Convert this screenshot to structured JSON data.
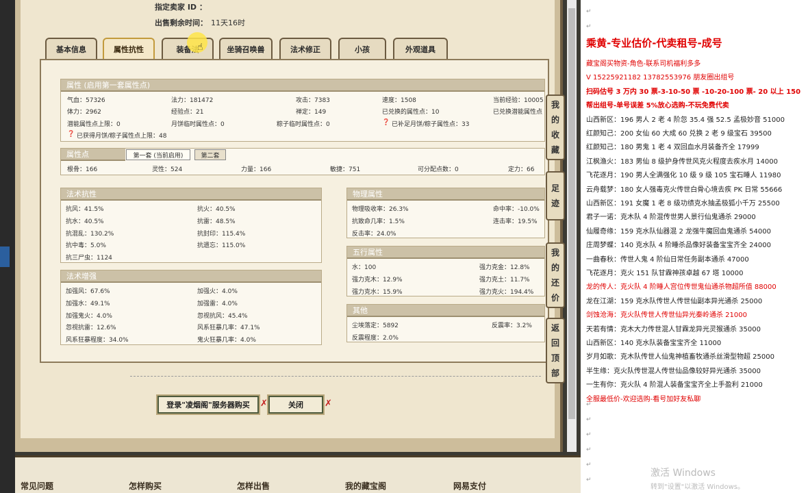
{
  "header": {
    "seller_id_label": "指定卖家 ID ：",
    "time_label": "出售剩余时间：",
    "time_value": "11天16时"
  },
  "tabs": [
    "基本信息",
    "属性抗性",
    "装备法",
    "坐骑召唤兽",
    "法术修正",
    "小孩",
    "外观道具"
  ],
  "attr_section": {
    "title": "属性 (启用第一套属性点)",
    "rows": [
      [
        "气血：57326",
        "法力：181472",
        "攻击：7383",
        "速度：1508",
        "当前经验：10005"
      ],
      [
        "体力：2962",
        "经验点：21",
        "禅定：149",
        "已兑换的属性点：10",
        "已兑换潜能属性点"
      ],
      [
        "潜能属性点上限：0",
        "月饼临时属性点：0",
        "粽子临时属性点：0",
        "已补足月饼/粽子属性点：33"
      ]
    ],
    "note": "已获得月饼/粽子属性点上限：48"
  },
  "points_section": {
    "title": "属性点",
    "subtab1": "第一套 (当前启用)",
    "subtab2": "第二套",
    "row": [
      "根骨：166",
      "灵性：524",
      "力量：166",
      "敏捷：751",
      "可分配点数：0",
      "定力：66"
    ]
  },
  "spell_resist": {
    "title": "法术抗性",
    "items": [
      "抗风：41.5%",
      "抗火：40.5%",
      "抗水：40.5%",
      "抗雷：48.5%",
      "抗混乱：130.2%",
      "抗封印：115.4%",
      "抗中毒：5.0%",
      "抗遗忘：115.0%",
      "抗三尸虫：1124"
    ]
  },
  "spell_boost": {
    "title": "法术增强",
    "items": [
      "加强风：67.6%",
      "加强火：4.0%",
      "加强水：49.1%",
      "加强雷：4.0%",
      "加强鬼火：4.0%",
      "忽视抗风：45.4%",
      "忽视抗雷：12.6%",
      "风系狂暴几率：47.1%",
      "风系狂暴程度：34.0%",
      "鬼火狂暴几率：4.0%"
    ]
  },
  "physical": {
    "title": "物理属性",
    "items": [
      "物理吸收率：26.3%",
      "命中率：-10.0%",
      "抗致命几率：1.5%",
      "连击率：19.5%",
      "反击率：24.0%"
    ]
  },
  "wuxing": {
    "title": "五行属性",
    "items": [
      "水：100",
      "强力克金：12.8%",
      "强力克木：12.9%",
      "强力克土：11.7%",
      "强力克水：15.9%",
      "强力克火：194.4%"
    ]
  },
  "other": {
    "title": "其他",
    "items": [
      "尘埃落定：5892",
      "反震率：3.2%",
      "反震程度：2.0%"
    ]
  },
  "side_buttons": [
    [
      "我",
      "的",
      "收",
      "藏"
    ],
    [
      "足",
      "迹"
    ],
    [
      "我",
      "的",
      "还",
      "价"
    ],
    [
      "返",
      "回",
      "顶",
      "部"
    ]
  ],
  "bottom_buttons": {
    "login": "登录\"凌烟阁\"服务器购买",
    "close": "关闭",
    "x": "✗"
  },
  "footer": [
    "常见问题",
    "怎样购买",
    "怎样出售",
    "我的藏宝阁",
    "网易支付"
  ],
  "doc": {
    "title": "乘黄-专业估价-代卖租号-成号",
    "mark": "↵",
    "lines": [
      {
        "t": "藏宝阁买物资-角色-联系司机福利多多",
        "c": "red"
      },
      {
        "t": "V 15225921182   13782553976 朋友圈出组号",
        "c": "red"
      },
      {
        "t": "扫码估号 3 万内 30 票-3-10-50 票  -10-20-100 票- 20 以上 150",
        "c": "redb"
      },
      {
        "t": "帮出组号-单号误差 5%放心选购-不玩免费代卖",
        "c": "redb"
      },
      {
        "t": "山西新区：196 男人 2 老 4 阶忽 35.4 强 52.5 孟极妙音 51000",
        "c": ""
      },
      {
        "t": "红颜知己：200 女仙 60 大成 60 兑换 2 老 9 级宝石 39500",
        "c": ""
      },
      {
        "t": "红颜知己：180 男鬼 1 老 4 双回血水月装备齐全 17999",
        "c": ""
      },
      {
        "t": "江枫渔火：183 男仙 8 级护身传世风克火程度去疾水月 14000",
        "c": ""
      },
      {
        "t": "飞花逐月：190 男人全满强化 10 级 9 级 105 宝石睡人 11980",
        "c": ""
      },
      {
        "t": "云舟载梦：180 女人强毒克火传世白骨心境去疾 PK 日常 55666",
        "c": ""
      },
      {
        "t": "山西新区：191 女魔 1 老 8 级功绩克水抽孟极狐小千万 25500",
        "c": ""
      },
      {
        "t": "君子一诺：克木队 4 阶混传世男人景行仙鬼通杀 29000",
        "c": ""
      },
      {
        "t": "仙履奇缘：159 克水队仙器混 2 龙强牛魔回血鬼通杀 54000",
        "c": ""
      },
      {
        "t": "庄周梦蝶：140 克水队 4 阶睡杀品像好装备宝宝齐全 24000",
        "c": ""
      },
      {
        "t": "一曲春秋：传世人鬼 4 阶仙日常任务副本通杀 47000",
        "c": ""
      },
      {
        "t": "飞花逐月：克火 151 队甘霖神孩卓越 67 塔 10000",
        "c": ""
      },
      {
        "t": "龙的传人：克火队 4 阶睡人宫位传世鬼仙通杀物超所值 88000",
        "c": "red"
      },
      {
        "t": "龙在江湖：159 克水队传世人传世仙副本异光通杀 25000",
        "c": ""
      },
      {
        "t": "剑蚀沧海：克火队传世人传世仙异光秦岭通杀 21000",
        "c": "red"
      },
      {
        "t": "天若有情：克木大力传世混人甘霖龙异光灵猴通杀 35000",
        "c": ""
      },
      {
        "t": "山西新区：140 克水队装备宝宝齐全 11000",
        "c": ""
      },
      {
        "t": "岁月如歌：克木队传世人仙鬼神植畜牧通杀丝滑型物超 25000",
        "c": ""
      },
      {
        "t": "半生缘：克火队传世混人传世仙品像较好异光通杀 35000",
        "c": ""
      },
      {
        "t": "一生有你：克火队 4 阶混人装备宝宝齐全上手盈利 21000",
        "c": ""
      },
      {
        "t": "全服最低价-欢迎选购-看号加好友私聊",
        "c": "red"
      }
    ],
    "watermark1": "激活 Windows",
    "watermark2": "转到\"设置\"以激活 Windows。"
  },
  "colors": {
    "accent_red": "#e00000",
    "frame": "#cdbd9b",
    "paper": "#efe6cf"
  }
}
